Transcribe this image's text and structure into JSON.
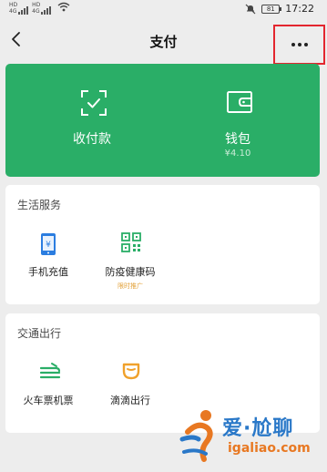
{
  "status_bar": {
    "sim1_tag": "HD",
    "sim1_net": "4G",
    "sim2_tag": "HD",
    "sim2_net": "4G",
    "battery": "81",
    "time": "17:22"
  },
  "header": {
    "title": "支付"
  },
  "pay_card": {
    "receive_label": "收付款",
    "wallet_label": "钱包",
    "wallet_balance": "¥4.10"
  },
  "life_services": {
    "header": "生活服务",
    "items": [
      {
        "label": "手机充值",
        "icon": "phone-topup-icon"
      },
      {
        "label": "防疫健康码",
        "icon": "qr-code-icon",
        "tag": "限时推广"
      }
    ]
  },
  "travel": {
    "header": "交通出行",
    "items": [
      {
        "label": "火车票机票",
        "icon": "train-icon"
      },
      {
        "label": "滴滴出行",
        "icon": "didi-icon"
      }
    ]
  },
  "watermark": {
    "text": "爱·尬聊",
    "url": "igaliao.com"
  },
  "colors": {
    "green": "#2aae67",
    "highlight_box": "#e3262f",
    "tag_orange": "#e3a23a"
  }
}
